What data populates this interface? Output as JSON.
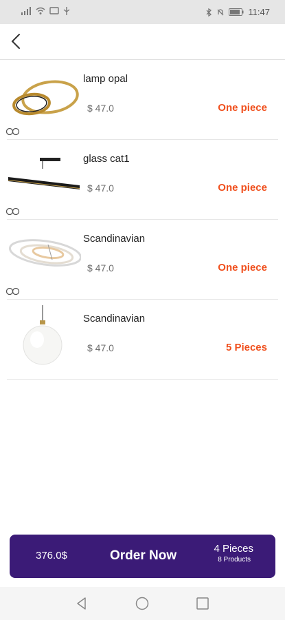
{
  "status_bar": {
    "time": "11:47"
  },
  "header": {
    "back_icon": "chevron-left-icon"
  },
  "items": [
    {
      "name": "lamp opal",
      "price": "$ 47.0",
      "quantity": "One piece"
    },
    {
      "name": "glass cat1",
      "price": "$ 47.0",
      "quantity": "One piece"
    },
    {
      "name": "Scandinavian",
      "price": "$ 47.0",
      "quantity": "One piece"
    },
    {
      "name": "Scandinavian",
      "price": "$ 47.0",
      "quantity": "5 Pieces"
    }
  ],
  "order": {
    "total": "376.0$",
    "label": "Order Now",
    "pieces": "4 Pieces",
    "products": "8 Products"
  },
  "colors": {
    "accent": "#f0501e",
    "primary": "#3b1b77"
  }
}
